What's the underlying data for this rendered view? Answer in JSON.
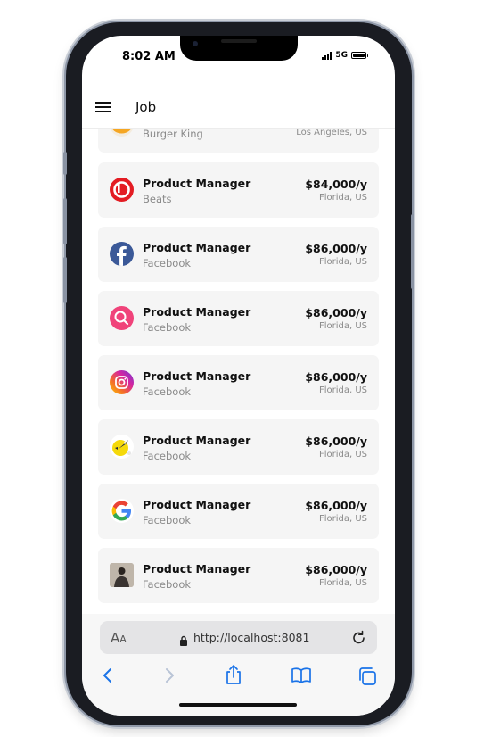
{
  "status_bar": {
    "time": "8:02 AM",
    "network": "5G"
  },
  "app_bar": {
    "title": "Job",
    "menu_icon": "hamburger-menu-icon"
  },
  "partial_job": {
    "company": "Burger King",
    "location": "Los Angeles, US",
    "logo_icon": "burger-king-logo-icon"
  },
  "jobs": [
    {
      "title": "Product Manager",
      "company": "Beats",
      "salary": "$84,000/y",
      "location": "Florida, US",
      "logo_icon": "beats-logo-icon",
      "color": "#e31c23"
    },
    {
      "title": "Product Manager",
      "company": "Facebook",
      "salary": "$86,000/y",
      "location": "Florida, US",
      "logo_icon": "facebook-logo-icon",
      "color": "#3b5998"
    },
    {
      "title": "Product Manager",
      "company": "Facebook",
      "salary": "$86,000/y",
      "location": "Florida, US",
      "logo_icon": "search-app-logo-icon",
      "color": "#f0437a"
    },
    {
      "title": "Product Manager",
      "company": "Facebook",
      "salary": "$86,000/y",
      "location": "Florida, US",
      "logo_icon": "instagram-logo-icon",
      "color": "#d6249f"
    },
    {
      "title": "Product Manager",
      "company": "Facebook",
      "salary": "$86,000/y",
      "location": "Florida, US",
      "logo_icon": "rocket-logo-icon",
      "color": "#f5d90a"
    },
    {
      "title": "Product Manager",
      "company": "Facebook",
      "salary": "$86,000/y",
      "location": "Florida, US",
      "logo_icon": "google-logo-icon",
      "color": "#4285f4"
    },
    {
      "title": "Product Manager",
      "company": "Facebook",
      "salary": "$86,000/y",
      "location": "Florida, US",
      "logo_icon": "person-photo-icon",
      "color": "#555555"
    }
  ],
  "browser": {
    "text_size_label": "AA",
    "url": "http://localhost:8081",
    "toolbar": [
      "back-icon",
      "forward-icon",
      "share-icon",
      "bookmarks-icon",
      "tabs-icon"
    ],
    "accent_color": "#1a73e8"
  }
}
